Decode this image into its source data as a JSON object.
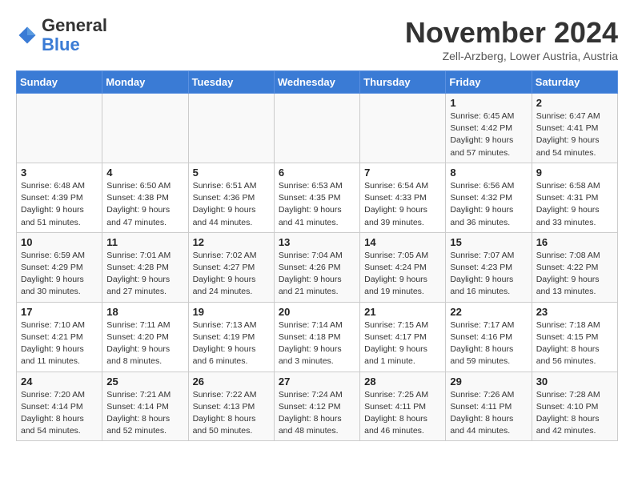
{
  "logo": {
    "general": "General",
    "blue": "Blue"
  },
  "title": "November 2024",
  "location": "Zell-Arzberg, Lower Austria, Austria",
  "days_of_week": [
    "Sunday",
    "Monday",
    "Tuesday",
    "Wednesday",
    "Thursday",
    "Friday",
    "Saturday"
  ],
  "weeks": [
    [
      {
        "day": "",
        "info": ""
      },
      {
        "day": "",
        "info": ""
      },
      {
        "day": "",
        "info": ""
      },
      {
        "day": "",
        "info": ""
      },
      {
        "day": "",
        "info": ""
      },
      {
        "day": "1",
        "info": "Sunrise: 6:45 AM\nSunset: 4:42 PM\nDaylight: 9 hours and 57 minutes."
      },
      {
        "day": "2",
        "info": "Sunrise: 6:47 AM\nSunset: 4:41 PM\nDaylight: 9 hours and 54 minutes."
      }
    ],
    [
      {
        "day": "3",
        "info": "Sunrise: 6:48 AM\nSunset: 4:39 PM\nDaylight: 9 hours and 51 minutes."
      },
      {
        "day": "4",
        "info": "Sunrise: 6:50 AM\nSunset: 4:38 PM\nDaylight: 9 hours and 47 minutes."
      },
      {
        "day": "5",
        "info": "Sunrise: 6:51 AM\nSunset: 4:36 PM\nDaylight: 9 hours and 44 minutes."
      },
      {
        "day": "6",
        "info": "Sunrise: 6:53 AM\nSunset: 4:35 PM\nDaylight: 9 hours and 41 minutes."
      },
      {
        "day": "7",
        "info": "Sunrise: 6:54 AM\nSunset: 4:33 PM\nDaylight: 9 hours and 39 minutes."
      },
      {
        "day": "8",
        "info": "Sunrise: 6:56 AM\nSunset: 4:32 PM\nDaylight: 9 hours and 36 minutes."
      },
      {
        "day": "9",
        "info": "Sunrise: 6:58 AM\nSunset: 4:31 PM\nDaylight: 9 hours and 33 minutes."
      }
    ],
    [
      {
        "day": "10",
        "info": "Sunrise: 6:59 AM\nSunset: 4:29 PM\nDaylight: 9 hours and 30 minutes."
      },
      {
        "day": "11",
        "info": "Sunrise: 7:01 AM\nSunset: 4:28 PM\nDaylight: 9 hours and 27 minutes."
      },
      {
        "day": "12",
        "info": "Sunrise: 7:02 AM\nSunset: 4:27 PM\nDaylight: 9 hours and 24 minutes."
      },
      {
        "day": "13",
        "info": "Sunrise: 7:04 AM\nSunset: 4:26 PM\nDaylight: 9 hours and 21 minutes."
      },
      {
        "day": "14",
        "info": "Sunrise: 7:05 AM\nSunset: 4:24 PM\nDaylight: 9 hours and 19 minutes."
      },
      {
        "day": "15",
        "info": "Sunrise: 7:07 AM\nSunset: 4:23 PM\nDaylight: 9 hours and 16 minutes."
      },
      {
        "day": "16",
        "info": "Sunrise: 7:08 AM\nSunset: 4:22 PM\nDaylight: 9 hours and 13 minutes."
      }
    ],
    [
      {
        "day": "17",
        "info": "Sunrise: 7:10 AM\nSunset: 4:21 PM\nDaylight: 9 hours and 11 minutes."
      },
      {
        "day": "18",
        "info": "Sunrise: 7:11 AM\nSunset: 4:20 PM\nDaylight: 9 hours and 8 minutes."
      },
      {
        "day": "19",
        "info": "Sunrise: 7:13 AM\nSunset: 4:19 PM\nDaylight: 9 hours and 6 minutes."
      },
      {
        "day": "20",
        "info": "Sunrise: 7:14 AM\nSunset: 4:18 PM\nDaylight: 9 hours and 3 minutes."
      },
      {
        "day": "21",
        "info": "Sunrise: 7:15 AM\nSunset: 4:17 PM\nDaylight: 9 hours and 1 minute."
      },
      {
        "day": "22",
        "info": "Sunrise: 7:17 AM\nSunset: 4:16 PM\nDaylight: 8 hours and 59 minutes."
      },
      {
        "day": "23",
        "info": "Sunrise: 7:18 AM\nSunset: 4:15 PM\nDaylight: 8 hours and 56 minutes."
      }
    ],
    [
      {
        "day": "24",
        "info": "Sunrise: 7:20 AM\nSunset: 4:14 PM\nDaylight: 8 hours and 54 minutes."
      },
      {
        "day": "25",
        "info": "Sunrise: 7:21 AM\nSunset: 4:14 PM\nDaylight: 8 hours and 52 minutes."
      },
      {
        "day": "26",
        "info": "Sunrise: 7:22 AM\nSunset: 4:13 PM\nDaylight: 8 hours and 50 minutes."
      },
      {
        "day": "27",
        "info": "Sunrise: 7:24 AM\nSunset: 4:12 PM\nDaylight: 8 hours and 48 minutes."
      },
      {
        "day": "28",
        "info": "Sunrise: 7:25 AM\nSunset: 4:11 PM\nDaylight: 8 hours and 46 minutes."
      },
      {
        "day": "29",
        "info": "Sunrise: 7:26 AM\nSunset: 4:11 PM\nDaylight: 8 hours and 44 minutes."
      },
      {
        "day": "30",
        "info": "Sunrise: 7:28 AM\nSunset: 4:10 PM\nDaylight: 8 hours and 42 minutes."
      }
    ]
  ]
}
